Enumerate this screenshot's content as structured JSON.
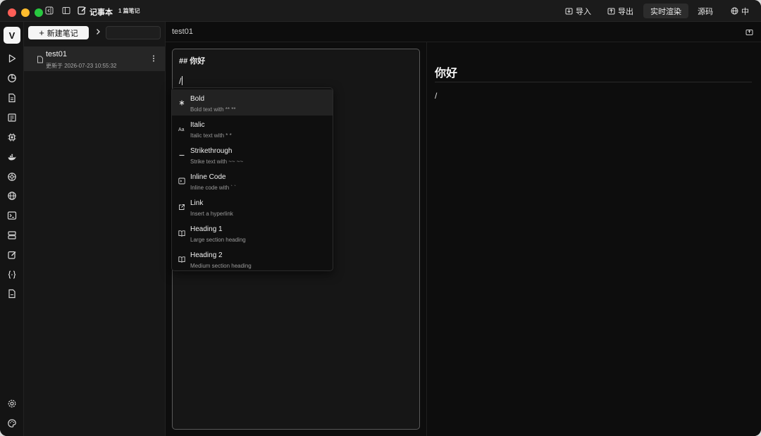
{
  "app": {
    "title": "记事本",
    "note_count": "1 篇笔记"
  },
  "toolbar": {
    "import_label": "导入",
    "export_label": "导出",
    "live_render_label": "实时渲染",
    "source_label": "源码",
    "language_label": "中"
  },
  "rail": {
    "logo": "V",
    "icons": [
      "play-icon",
      "pie-chart-icon",
      "document-icon",
      "newspaper-icon",
      "chip-icon",
      "docker-icon",
      "aperture-icon",
      "globe-icon",
      "terminal-icon",
      "server-icon",
      "edit-icon",
      "braces-icon",
      "file-code-icon",
      "settings-icon",
      "palette-icon"
    ]
  },
  "notes_panel": {
    "new_note_label": "新建笔记",
    "search_placeholder": "",
    "items": [
      {
        "title": "test01",
        "updated": "更新于 2026-07-23 10:55:32"
      }
    ]
  },
  "main": {
    "title": "test01",
    "editor": {
      "line1": "## 你好",
      "line2": "/"
    },
    "preview": {
      "heading": "你好",
      "text": "/"
    }
  },
  "slash_menu": {
    "items": [
      {
        "label": "Bold",
        "desc": "Bold text with ** **",
        "icon": "asterisk-icon"
      },
      {
        "label": "Italic",
        "desc": "Italic text with * *",
        "icon": "italic-aa-icon"
      },
      {
        "label": "Strikethrough",
        "desc": "Strike text with ~~ ~~",
        "icon": "strikethrough-icon"
      },
      {
        "label": "Inline Code",
        "desc": "Inline code with ` `",
        "icon": "code-box-icon"
      },
      {
        "label": "Link",
        "desc": "Insert a hyperlink",
        "icon": "external-link-icon"
      },
      {
        "label": "Heading 1",
        "desc": "Large section heading",
        "icon": "book-icon"
      },
      {
        "label": "Heading 2",
        "desc": "Medium section heading",
        "icon": "book-icon"
      }
    ]
  }
}
